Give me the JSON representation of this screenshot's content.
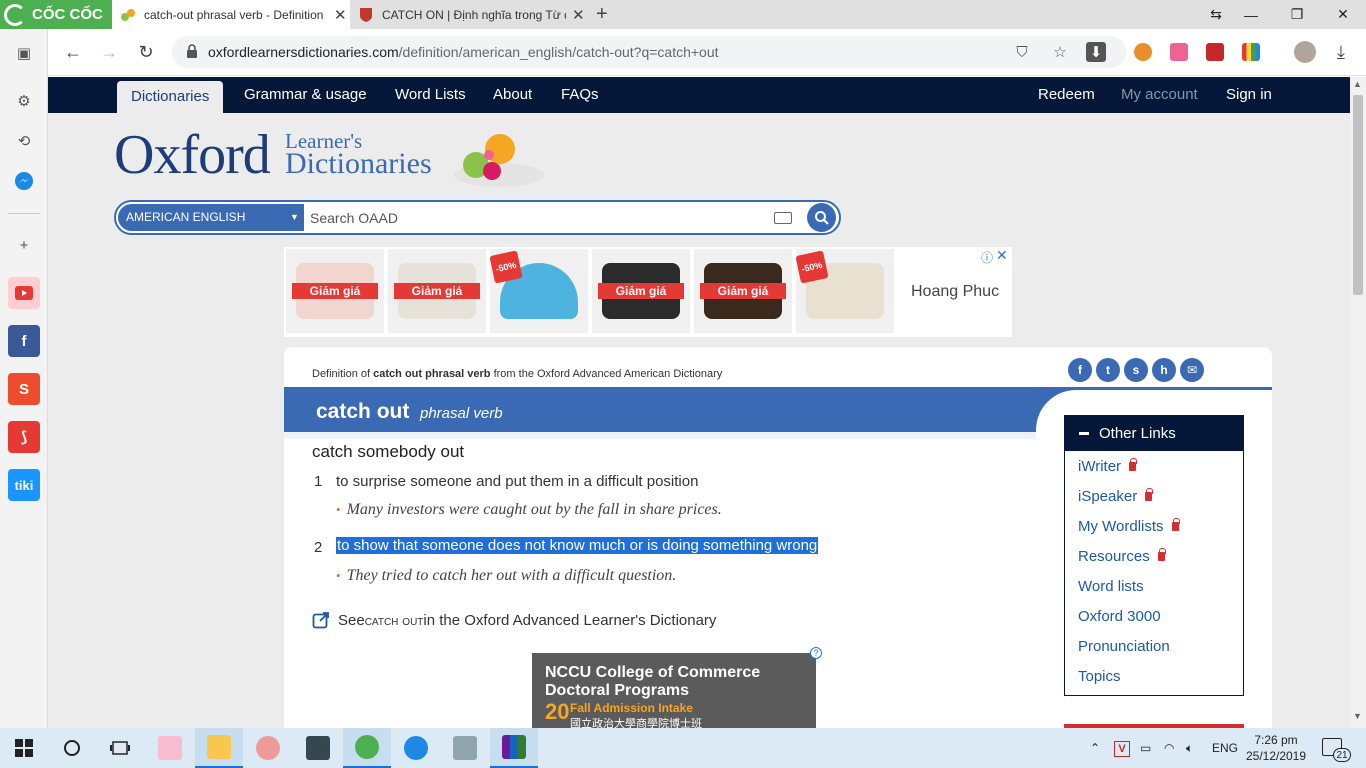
{
  "browser": {
    "brand": "CỐC CỐC",
    "tabs": [
      {
        "title": "catch-out phrasal verb - Definition",
        "active": true
      },
      {
        "title": "CATCH ON | Định nghĩa trong Từ điển",
        "active": false
      }
    ],
    "url_domain": "oxfordlearnersdictionaries.com",
    "url_path": "/definition/american_english/catch-out?q=catch+out"
  },
  "site_nav": {
    "items": [
      "Dictionaries",
      "Grammar & usage",
      "Word Lists",
      "About",
      "FAQs"
    ],
    "right_items": [
      "Redeem",
      "My account",
      "Sign in"
    ]
  },
  "logo": {
    "oxford": "Oxford",
    "learners": "Learner's",
    "dictionaries": "Dictionaries"
  },
  "search": {
    "language": "AMERICAN ENGLISH",
    "placeholder": "Search OAAD"
  },
  "ad_strip": {
    "sale_label": "Giảm giá",
    "discount": "-50%",
    "brand": "Hoang Phuc"
  },
  "entry": {
    "source_prefix": "Definition of ",
    "source_term": "catch out phrasal verb",
    "source_suffix": " from the Oxford Advanced American Dictionary",
    "headword": "catch out",
    "pos": "phrasal verb",
    "phrase": "catch somebody out",
    "senses": [
      {
        "num": "1",
        "definition": "to surprise someone and put them in a difficult position",
        "example": "Many investors were caught out by the fall in share prices.",
        "selected": false
      },
      {
        "num": "2",
        "definition": "to show that someone does not know much or is doing something wrong",
        "example": "They tried to catch her out with a difficult question.",
        "selected": true
      }
    ],
    "see_also_prefix": "See ",
    "see_also_term": "catch out",
    "see_also_suffix": " in the Oxford Advanced Learner's Dictionary"
  },
  "bottom_ad": {
    "title_line1": "NCCU College of Commerce",
    "title_line2": "Doctoral Programs",
    "subtitle": "Fall Admission Intake",
    "chinese": "國立政治大學商學院博士班",
    "number": "20"
  },
  "other_links": {
    "title": "Other Links",
    "items": [
      {
        "label": "iWriter",
        "locked": true
      },
      {
        "label": "iSpeaker",
        "locked": true
      },
      {
        "label": "My Wordlists",
        "locked": true
      },
      {
        "label": "Resources",
        "locked": true
      },
      {
        "label": "Word lists",
        "locked": false
      },
      {
        "label": "Oxford 3000",
        "locked": false
      },
      {
        "label": "Pronunciation",
        "locked": false
      },
      {
        "label": "Topics",
        "locked": false
      }
    ]
  },
  "taskbar": {
    "language": "ENG",
    "time": "7:26 pm",
    "date": "25/12/2019",
    "notifications": "21"
  },
  "colors": {
    "oxford_navy": "#061839",
    "oxford_blue": "#3a6ab3",
    "selection": "#1e6fd9",
    "sale_red": "#e53935",
    "coccoc_green": "#4caf50"
  }
}
